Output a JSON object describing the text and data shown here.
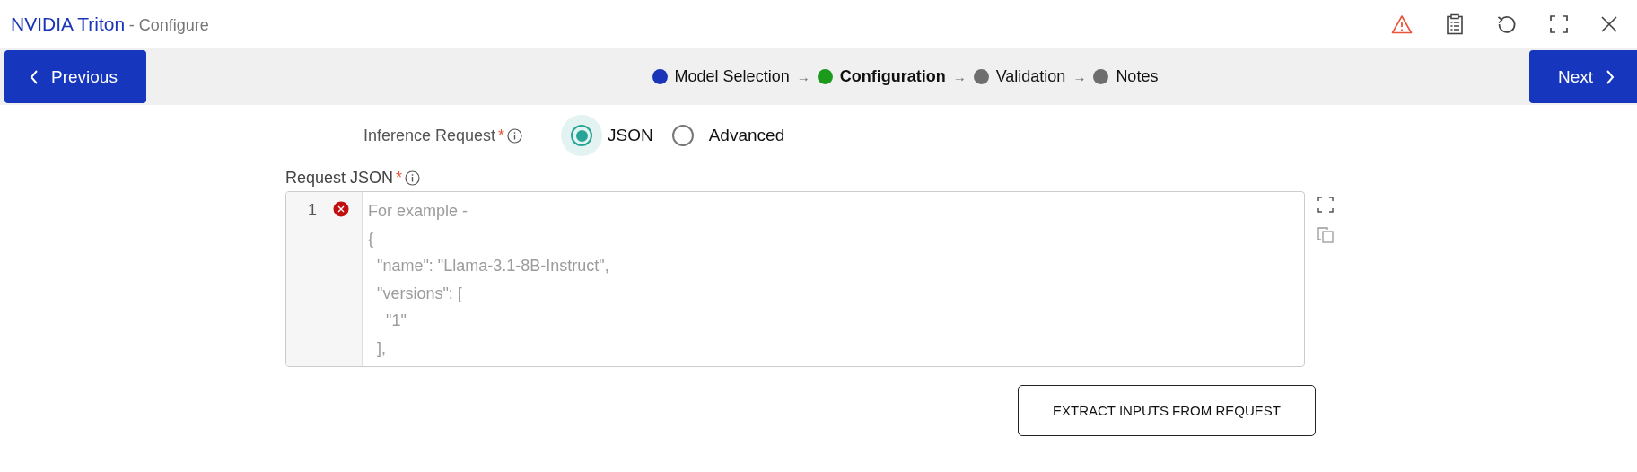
{
  "header": {
    "title": "NVIDIA Triton",
    "subtitle": "- Configure"
  },
  "steps_bar": {
    "previous": "Previous",
    "next": "Next",
    "steps": [
      {
        "label": "Model Selection",
        "color": "#1a35b8",
        "selected": false
      },
      {
        "arrow": "→",
        "label": "Configuration",
        "color": "#1b9a1b",
        "selected": true
      },
      {
        "arrow": "→",
        "label": "Validation",
        "color": "#6e6e6e",
        "selected": false
      },
      {
        "arrow": "→",
        "label": "Notes",
        "color": "#6e6e6e",
        "selected": false
      }
    ]
  },
  "form": {
    "inference_request": {
      "label": "Inference Request",
      "required": "*",
      "options": [
        {
          "label": "JSON",
          "selected": true
        },
        {
          "label": "Advanced",
          "selected": false
        }
      ]
    },
    "request_json": {
      "label": "Request JSON",
      "required": "*",
      "line_number": "1",
      "error": true,
      "placeholder_lines": [
        "For example -",
        "{",
        "  \"name\": \"Llama-3.1-8B-Instruct\",",
        "  \"versions\": [",
        "    \"1\"",
        "  ],"
      ]
    },
    "extract_button": "EXTRACT INPUTS FROM REQUEST"
  }
}
